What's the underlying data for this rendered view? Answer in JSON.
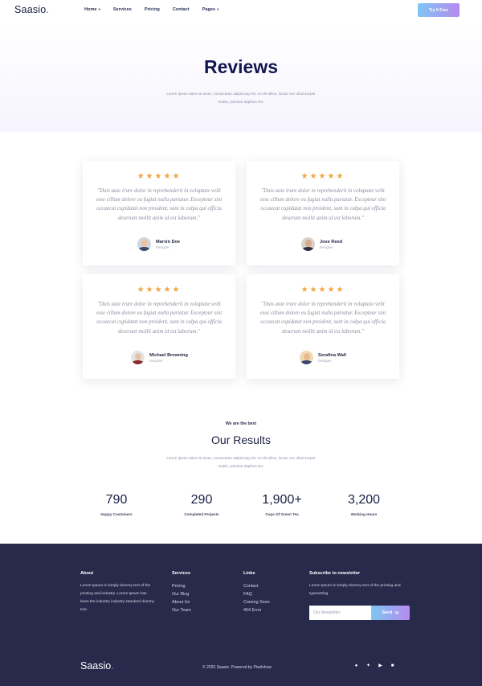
{
  "nav": {
    "logo": "Saasio",
    "logo_dot": ".",
    "menu": [
      {
        "label": "Home",
        "has_caret": true
      },
      {
        "label": "Services",
        "has_caret": false
      },
      {
        "label": "Pricing",
        "has_caret": false
      },
      {
        "label": "Contact",
        "has_caret": false
      },
      {
        "label": "Pages",
        "has_caret": true
      }
    ],
    "cta": "Try It Free"
  },
  "hero": {
    "title": "Reviews",
    "subtitle": "Lorem ipsum dolor sit amet, consectetur adipiscing elit. Ut elit tellus, luctus nec ullamcorper mattis, pulvinar dapibus leo."
  },
  "reviews": [
    {
      "stars": "★★★★★",
      "quote": "\"Duis aute irure dolor in reprehenderit in voluptate velit esse cillum dolore eu fugiat nulla pariatur. Excepteur sint occaecat cupidatat non proident, sunt in culpa qui officia deserunt mollit anim id est laborum.\"",
      "name": "Marvin Doe",
      "role": "Designer"
    },
    {
      "stars": "★★★★★",
      "quote": "\"Duis aute irure dolor in reprehenderit in voluptate velit esse cillum dolore eu fugiat nulla pariatur. Excepteur sint occaecat cupidatat non proident, sunt in culpa qui officia deserunt mollit anim id est laborum.\"",
      "name": "Jose Reed",
      "role": "Designer"
    },
    {
      "stars": "★★★★★",
      "quote": "\"Duis aute irure dolor in reprehenderit in voluptate velit esse cillum dolore eu fugiat nulla pariatur. Excepteur sint occaecat cupidatat non proident, sunt in culpa qui officia deserunt mollit anim id est laborum.\"",
      "name": "Michael Browning",
      "role": "Designer"
    },
    {
      "stars": "★★★★★",
      "quote": "\"Duis aute irure dolor in reprehenderit in voluptate velit esse cillum dolore eu fugiat nulla pariatur. Excepteur sint occaecat cupidatat non proident, sunt in culpa qui officia deserunt mollit anim id est laborum.\"",
      "name": "Serafina Wall",
      "role": "Designer"
    }
  ],
  "results": {
    "eyebrow": "We are the best",
    "title": "Our Results",
    "subtitle": "Lorem ipsum dolor sit amet, consectetur adipiscing elit. Ut elit tellus, luctus nec ullamcorper mattis, pulvinar dapibus leo.",
    "stats": [
      {
        "number": "790",
        "label": "Happy Customers"
      },
      {
        "number": "290",
        "label": "Completed Projects"
      },
      {
        "number": "1,900+",
        "label": "Cups Of Green Tea"
      },
      {
        "number": "3,200",
        "label": "Working Hours"
      }
    ]
  },
  "footer": {
    "about": {
      "heading": "About",
      "text": "Lorem Ipsum is simply dummy text of the printing and industry. Lorem Ipsum has been the industry industry standard dummy text."
    },
    "services": {
      "heading": "Services",
      "links": [
        "Pricing",
        "Our Blog",
        "About Us",
        "Our Team"
      ]
    },
    "links": {
      "heading": "Links",
      "links": [
        "Contact",
        "FAQ",
        "Coming Soon",
        "404 Error"
      ]
    },
    "newsletter": {
      "heading": "Subscribe to newsletter",
      "text": "Lorem Ipsum is simply dummy text of the printing and typesetting.",
      "placeholder": "Our Newsletter",
      "button": "Send",
      "button_icon": "✉"
    },
    "logo": "Saasio",
    "logo_dot": ".",
    "copyright": "© 2020 Saasio. Powered by Pixelshow",
    "social": [
      {
        "name": "facebook-icon",
        "glyph": "●"
      },
      {
        "name": "twitter-icon",
        "glyph": "✦"
      },
      {
        "name": "youtube-icon",
        "glyph": "▶"
      },
      {
        "name": "linkedin-icon",
        "glyph": "■"
      }
    ]
  },
  "colors": {
    "accent_start": "#7fc6f2",
    "accent_end": "#b58af0",
    "star": "#f2a440",
    "footer_bg": "#272a4b",
    "heading": "#121650"
  }
}
